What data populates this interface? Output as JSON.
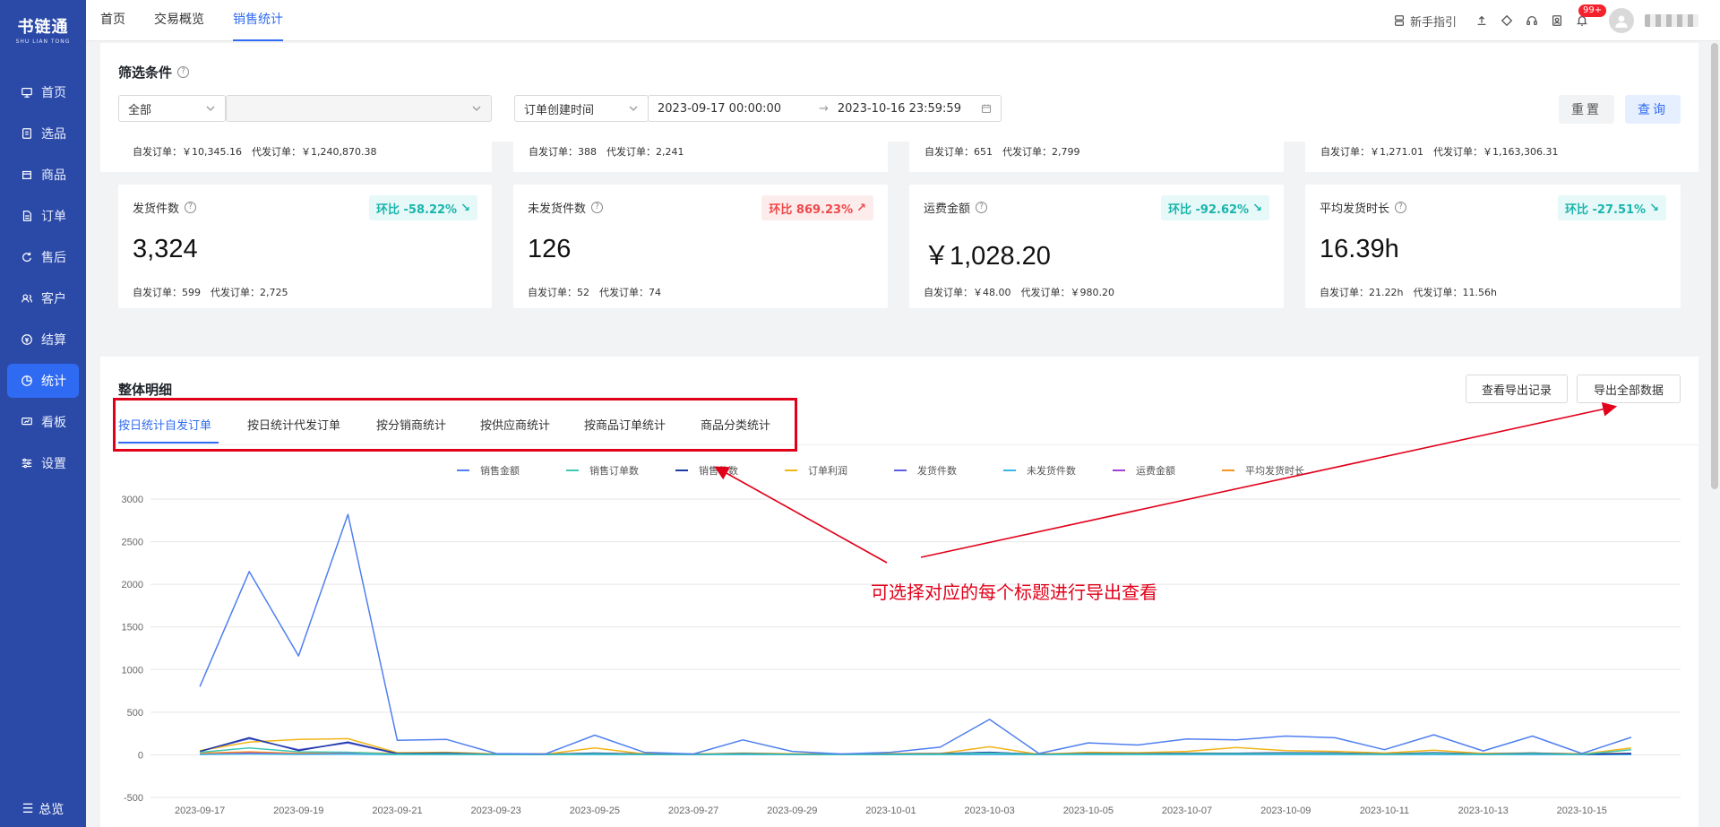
{
  "sidebar": {
    "logo_main": "书链通",
    "logo_sub": "SHU LIAN TONG",
    "items": [
      {
        "label": "首页",
        "icon": "monitor-icon"
      },
      {
        "label": "选品",
        "icon": "clipboard-icon"
      },
      {
        "label": "商品",
        "icon": "box-icon"
      },
      {
        "label": "订单",
        "icon": "order-icon"
      },
      {
        "label": "售后",
        "icon": "refresh-icon"
      },
      {
        "label": "客户",
        "icon": "users-icon"
      },
      {
        "label": "结算",
        "icon": "settlement-icon"
      },
      {
        "label": "统计",
        "icon": "pie-chart-icon"
      },
      {
        "label": "看板",
        "icon": "dashboard-icon"
      },
      {
        "label": "设置",
        "icon": "sliders-icon"
      }
    ],
    "active": "统计",
    "collapse_label": "总览"
  },
  "topbar": {
    "tabs": [
      "首页",
      "交易概览",
      "销售统计"
    ],
    "active_tab": "销售统计",
    "guide_label": "新手指引",
    "notification_badge": "99+"
  },
  "filter": {
    "title": "筛选条件",
    "scope_value": "全部",
    "secondary_value": "",
    "date_type": "订单创建时间",
    "start_time": "2023-09-17 00:00:00",
    "end_time": "2023-10-16 23:59:59",
    "reset_label": "重置",
    "query_label": "查询"
  },
  "summary_subs": [
    "自发订单：￥10,345.16　代发订单：￥1,240,870.38",
    "自发订单：388　代发订单：2,241",
    "自发订单：651　代发订单：2,799",
    "自发订单：￥1,271.01　代发订单：￥1,163,306.31"
  ],
  "cards": [
    {
      "title": "发货件数",
      "value": "3,324",
      "change": "环比 -58.22%",
      "direction": "down",
      "sub": "自发订单：599　代发订单：2,725"
    },
    {
      "title": "未发货件数",
      "value": "126",
      "change": "环比 869.23%",
      "direction": "up",
      "sub": "自发订单：52　代发订单：74"
    },
    {
      "title": "运费金额",
      "value": "￥1,028.20",
      "change": "环比 -92.62%",
      "direction": "down",
      "sub": "自发订单：￥48.00　代发订单：￥980.20"
    },
    {
      "title": "平均发货时长",
      "value": "16.39h",
      "change": "环比 -27.51%",
      "direction": "down",
      "sub": "自发订单：21.22h　代发订单：11.56h"
    }
  ],
  "detail": {
    "title": "整体明细",
    "view_export_label": "查看导出记录",
    "export_all_label": "导出全部数据",
    "tabs": [
      "按日统计自发订单",
      "按日统计代发订单",
      "按分销商统计",
      "按供应商统计",
      "按商品订单统计",
      "商品分类统计"
    ],
    "active_tab": "按日统计自发订单"
  },
  "annotation": "可选择对应的每个标题进行导出查看",
  "colors": {
    "sidebar": "#2b4aa8",
    "accent": "#2f6bf2",
    "annotation": "#e1001a"
  },
  "chart_data": {
    "type": "line",
    "x": [
      "2023-09-17",
      "2023-09-18",
      "2023-09-19",
      "2023-09-20",
      "2023-09-21",
      "2023-09-22",
      "2023-09-23",
      "2023-09-24",
      "2023-09-25",
      "2023-09-26",
      "2023-09-27",
      "2023-09-28",
      "2023-09-29",
      "2023-09-30",
      "2023-10-01",
      "2023-10-02",
      "2023-10-03",
      "2023-10-04",
      "2023-10-05",
      "2023-10-06",
      "2023-10-07",
      "2023-10-08",
      "2023-10-09",
      "2023-10-10",
      "2023-10-11",
      "2023-10-12",
      "2023-10-13",
      "2023-10-14",
      "2023-10-15",
      "2023-10-16"
    ],
    "xticks": [
      "2023-09-17",
      "2023-09-19",
      "2023-09-21",
      "2023-09-23",
      "2023-09-25",
      "2023-09-27",
      "2023-09-29",
      "2023-10-01",
      "2023-10-03",
      "2023-10-05",
      "2023-10-07",
      "2023-10-09",
      "2023-10-11",
      "2023-10-13",
      "2023-10-15"
    ],
    "ylim": [
      -500,
      3000
    ],
    "yticks": [
      -500,
      0,
      500,
      1000,
      1500,
      2000,
      2500,
      3000
    ],
    "grid": true,
    "legend_position": "top",
    "series": [
      {
        "name": "销售金额",
        "color": "#4f7ff0",
        "values": [
          800,
          2150,
          1160,
          2820,
          170,
          180,
          15,
          10,
          230,
          30,
          10,
          175,
          40,
          10,
          30,
          90,
          415,
          15,
          140,
          115,
          185,
          175,
          220,
          200,
          60,
          235,
          45,
          220,
          15,
          205
        ]
      },
      {
        "name": "销售订单数",
        "color": "#3fc7b4",
        "values": [
          30,
          80,
          35,
          30,
          8,
          10,
          3,
          3,
          12,
          5,
          3,
          10,
          4,
          2,
          5,
          8,
          20,
          3,
          10,
          8,
          12,
          12,
          15,
          14,
          6,
          16,
          5,
          14,
          3,
          60
        ]
      },
      {
        "name": "销售件数",
        "color": "#1f3aa6",
        "values": [
          40,
          200,
          50,
          150,
          15,
          20,
          5,
          5,
          20,
          8,
          5,
          15,
          6,
          4,
          8,
          12,
          30,
          5,
          15,
          12,
          18,
          18,
          22,
          20,
          9,
          25,
          8,
          20,
          5,
          15
        ]
      },
      {
        "name": "订单利润",
        "color": "#f2b517",
        "values": [
          50,
          150,
          180,
          190,
          25,
          30,
          10,
          8,
          80,
          10,
          8,
          20,
          12,
          6,
          10,
          15,
          95,
          5,
          30,
          25,
          40,
          85,
          50,
          40,
          20,
          55,
          15,
          20,
          8,
          80
        ]
      },
      {
        "name": "发货件数",
        "color": "#5b5fe0",
        "values": [
          40,
          190,
          60,
          140,
          12,
          20,
          5,
          5,
          18,
          8,
          5,
          14,
          6,
          4,
          8,
          12,
          28,
          5,
          14,
          12,
          16,
          18,
          20,
          20,
          8,
          22,
          8,
          18,
          5,
          15
        ]
      },
      {
        "name": "未发货件数",
        "color": "#39b6e8",
        "values": [
          5,
          10,
          5,
          8,
          2,
          3,
          1,
          1,
          3,
          2,
          1,
          2,
          1,
          1,
          2,
          2,
          4,
          1,
          2,
          2,
          3,
          3,
          3,
          3,
          2,
          3,
          1,
          3,
          1,
          2
        ]
      },
      {
        "name": "运费金额",
        "color": "#a23fd0",
        "values": [
          5,
          20,
          8,
          15,
          2,
          3,
          1,
          1,
          4,
          2,
          1,
          3,
          1,
          1,
          2,
          2,
          6,
          1,
          3,
          2,
          3,
          3,
          4,
          4,
          2,
          4,
          1,
          3,
          1,
          2
        ]
      },
      {
        "name": "平均发货时长",
        "color": "#f7941d",
        "values": [
          20,
          35,
          18,
          30,
          15,
          18,
          10,
          12,
          16,
          14,
          10,
          15,
          12,
          10,
          14,
          16,
          22,
          12,
          18,
          16,
          20,
          18,
          22,
          20,
          15,
          22,
          16,
          20,
          12,
          18
        ]
      }
    ]
  }
}
